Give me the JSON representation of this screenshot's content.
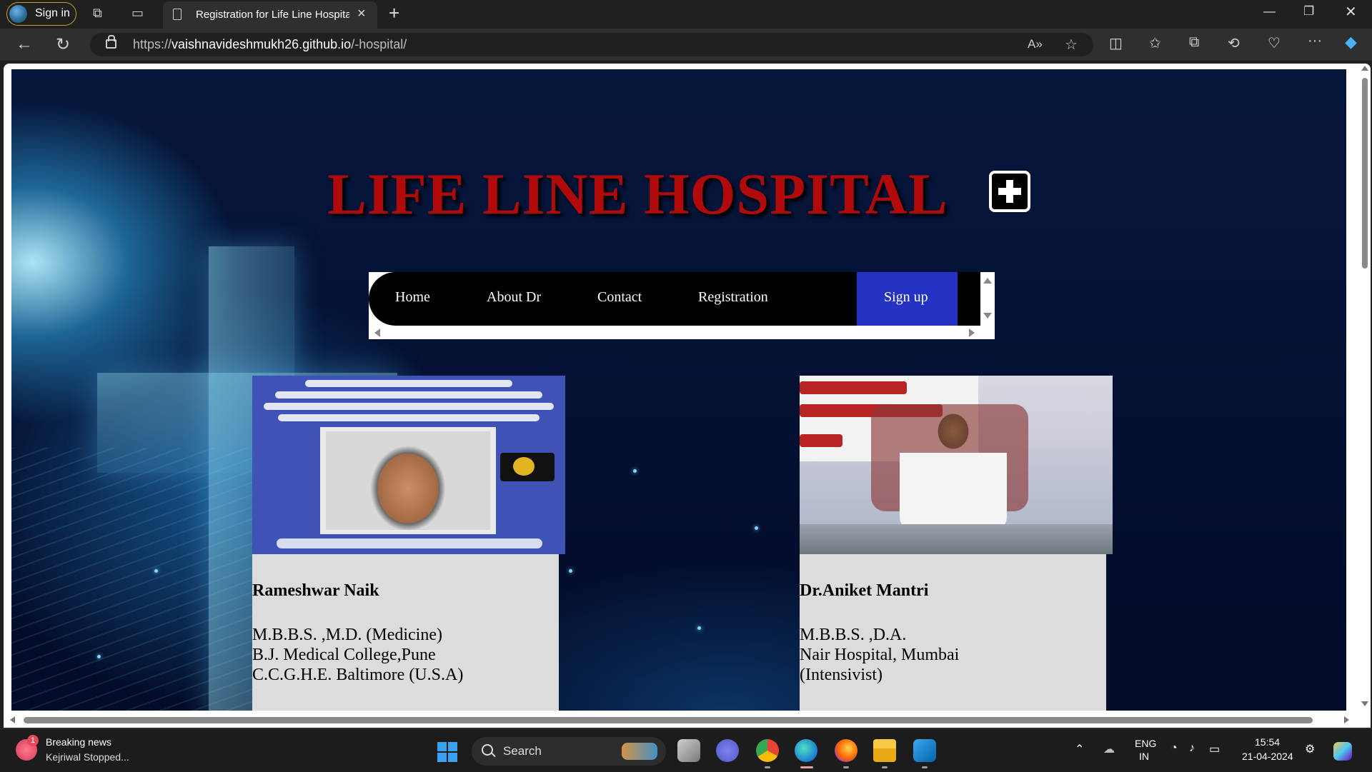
{
  "browser": {
    "signin_label": "Sign in",
    "tab_title": "Registration for Life Line Hospital",
    "url_prefix": "https://",
    "url_host": "vaishnavideshmukh26.github.io",
    "url_path": "/-hospital/"
  },
  "page": {
    "title": "LIFE LINE HOSPITAL",
    "nav": [
      "Home",
      "About Dr",
      "Contact",
      "Registration"
    ],
    "signup_label": "Sign up",
    "doctors": [
      {
        "name": "Rameshwar Naik",
        "qualifications": [
          "M.B.B.S. ,M.D. (Medicine)",
          "B.J. Medical College,Pune",
          "C.C.G.H.E. Baltimore (U.S.A)"
        ]
      },
      {
        "name": "Dr.Aniket Mantri",
        "qualifications": [
          "M.B.B.S. ,D.A.",
          "Nair Hospital, Mumbai",
          "(Intensivist)"
        ]
      }
    ]
  },
  "taskbar": {
    "news_title": "Breaking news",
    "news_sub": "Kejriwal Stopped...",
    "news_badge": "1",
    "search_label": "Search",
    "lang_top": "ENG",
    "lang_bottom": "IN",
    "time": "15:54",
    "date": "21-04-2024"
  },
  "colors": {
    "title_red": "#b10a0a",
    "signup_blue": "#2433c4",
    "navbar_black": "#000000"
  }
}
